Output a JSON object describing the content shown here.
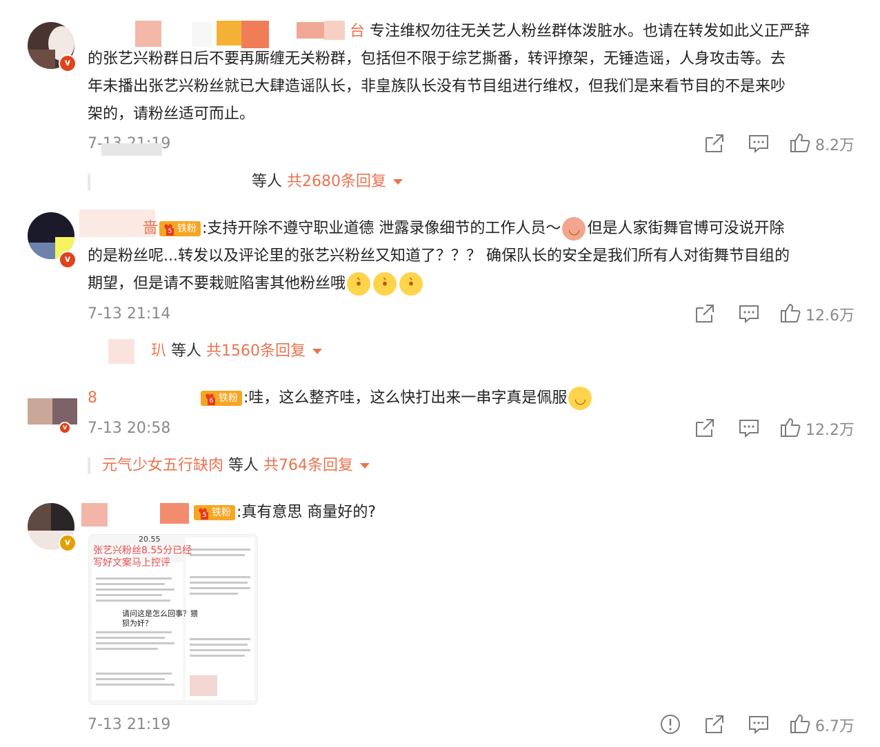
{
  "comments": [
    {
      "text_lines": [
        "专注维权勿往无关艺人粉丝群体泼脏水。也请在转发如此义正严辞",
        "的张艺兴粉群日后不要再厮缠无关粉群，包括但不限于综艺撕番，转评撩架，无锤造谣，人身攻击等。去",
        "年未播出张艺兴粉丝就已大肆造谣队长，非皇族队长没有节目组进行维权，但我们是来看节目的不是来吵",
        "架的，请粉丝适可而止。"
      ],
      "name_fragment": "台",
      "time": "7-13 21:19",
      "likes": "8.2万",
      "reply_name_fragment": "",
      "reply_mid": "等人",
      "reply_count": "共2680条回复"
    },
    {
      "name_fragment": "啬",
      "fan_badge": "铁粉",
      "fan_level": "5",
      "text_lines": [
        ":支持开除不遵守职业道德 泄露录像细节的工作人员～",
        "但是人家街舞官博可没说开除",
        "的是粉丝呢...转发以及评论里的张艺兴粉丝又知道了？？？ 确保队长的安全是我们所有人对街舞节目组的",
        "期望，但是请不要栽赃陷害其他粉丝哦"
      ],
      "time": "7-13 21:14",
      "likes": "12.6万",
      "reply_name_fragment": "玐",
      "reply_mid": "等人",
      "reply_count": "共1560条回复"
    },
    {
      "name_fragment": "8",
      "fan_badge": "铁粉",
      "fan_level": "6",
      "text_lines": [
        ":哇，这么整齐哇，这么快打出来一串字真是佩服"
      ],
      "time": "7-13 20:58",
      "likes": "12.2万",
      "reply_name_fragment": "元气少女五行缺肉",
      "reply_mid": "等人",
      "reply_count": "共764条回复"
    },
    {
      "name_fragment": "",
      "fan_badge": "铁粉",
      "fan_level": "5",
      "text_lines": [
        ":真有意思 商量好的?"
      ],
      "time": "7-13 21:19",
      "likes": "6.7万",
      "thumb": {
        "top_number": "20.55",
        "title": "张艺兴粉丝8.55分已经写好文案马上控评",
        "question": "请问这是怎么回事？猥 狈为奸？"
      }
    }
  ],
  "icons": {
    "share": "share-icon",
    "comment": "comment-icon",
    "like": "like-icon",
    "report": "report-icon",
    "dropdown": "chevron-down-icon"
  },
  "colors": {
    "accent": "#eb7350",
    "meta": "#8a8a8a",
    "fan_badge": "#f5a623"
  }
}
